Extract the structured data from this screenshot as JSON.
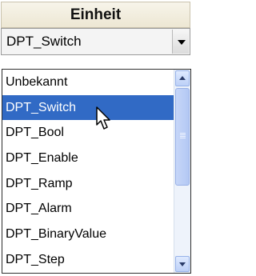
{
  "header": {
    "title": "Einheit"
  },
  "combo": {
    "value": "DPT_Switch"
  },
  "list": {
    "items": [
      "Unbekannt",
      "DPT_Switch",
      "DPT_Bool",
      "DPT_Enable",
      "DPT_Ramp",
      "DPT_Alarm",
      "DPT_BinaryValue",
      "DPT_Step"
    ],
    "selected_index": 1
  },
  "colors": {
    "header_bg": "#efe9d7",
    "selection": "#316ac5",
    "scrollbar": "#bcd0f7"
  },
  "icons": {
    "combo_arrow": "chevron-down-icon",
    "scroll_up": "scroll-up-icon",
    "scroll_down": "scroll-down-icon",
    "cursor": "mouse-cursor-icon"
  }
}
